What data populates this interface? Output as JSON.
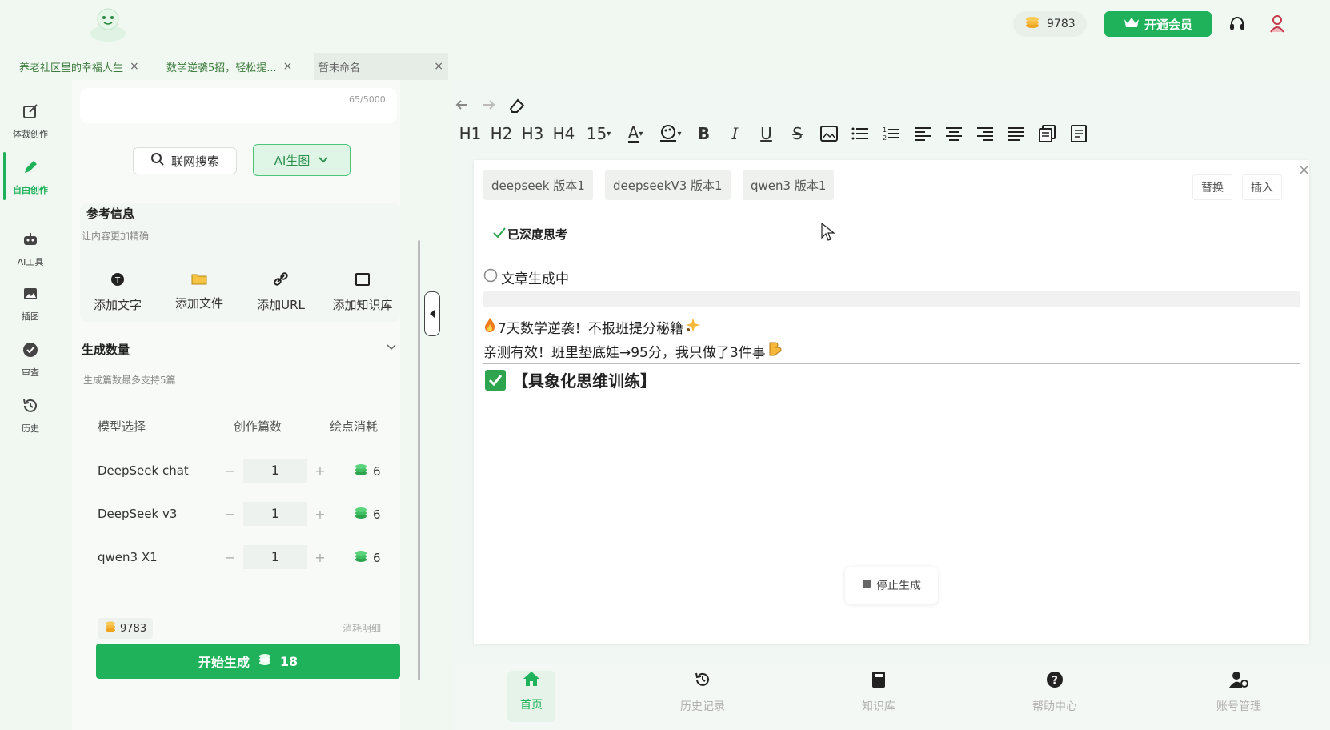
{
  "header": {
    "coins": "9783",
    "vip_label": "开通会员"
  },
  "doc_tabs": [
    {
      "label": "养老社区里的幸福人生",
      "close": "×"
    },
    {
      "label": "数学逆袭5招，轻松提...",
      "close": "×"
    },
    {
      "label": "暂未命名",
      "close": "×"
    }
  ],
  "rail": {
    "items": [
      {
        "label": "体裁创作"
      },
      {
        "label": "自由创作"
      },
      {
        "label": "AI工具"
      },
      {
        "label": "插图"
      },
      {
        "label": "审查"
      },
      {
        "label": "历史"
      }
    ]
  },
  "panel": {
    "char_counter": "65/5000",
    "search_btn": "联网搜索",
    "ai_image_btn": "AI生图",
    "ref_title": "参考信息",
    "ref_sub": "让内容更加精确",
    "add_items": [
      "添加文字",
      "添加文件",
      "添加URL",
      "添加知识库"
    ],
    "gen_title": "生成数量",
    "gen_sub": "生成篇数最多支持5篇",
    "table_headers": [
      "模型选择",
      "创作篇数",
      "绘点消耗"
    ],
    "rows": [
      {
        "model": "DeepSeek chat",
        "count": "1",
        "cost": "6"
      },
      {
        "model": "DeepSeek v3",
        "count": "1",
        "cost": "6"
      },
      {
        "model": "qwen3 X1",
        "count": "1",
        "cost": "6"
      }
    ],
    "minus": "−",
    "plus": "+",
    "balance": "9783",
    "consume_link": "消耗明细",
    "start_label": "开始生成",
    "start_cost": "18"
  },
  "toolbar": [
    "H1",
    "H2",
    "H3",
    "H4",
    "15"
  ],
  "editor": {
    "versions": [
      "deepseek 版本1",
      "deepseekV3 版本1",
      "qwen3 版本1"
    ],
    "replace_btn": "替换",
    "insert_btn": "插入",
    "close": "×",
    "thinking": "已深度思考",
    "gen_status": "文章生成中",
    "line1": "7天数学逆袭！不报班提分秘籍",
    "line2": "亲测有效！班里垫底娃→95分，我只做了3件事",
    "heading": "【具象化思维训练】",
    "stop_label": "停止生成"
  },
  "bottom_nav": [
    {
      "label": "首页"
    },
    {
      "label": "历史记录"
    },
    {
      "label": "知识库"
    },
    {
      "label": "帮助中心"
    },
    {
      "label": "账号管理"
    }
  ],
  "colors": {
    "accent": "#1fb25a",
    "bg": "#f1f8f2"
  }
}
